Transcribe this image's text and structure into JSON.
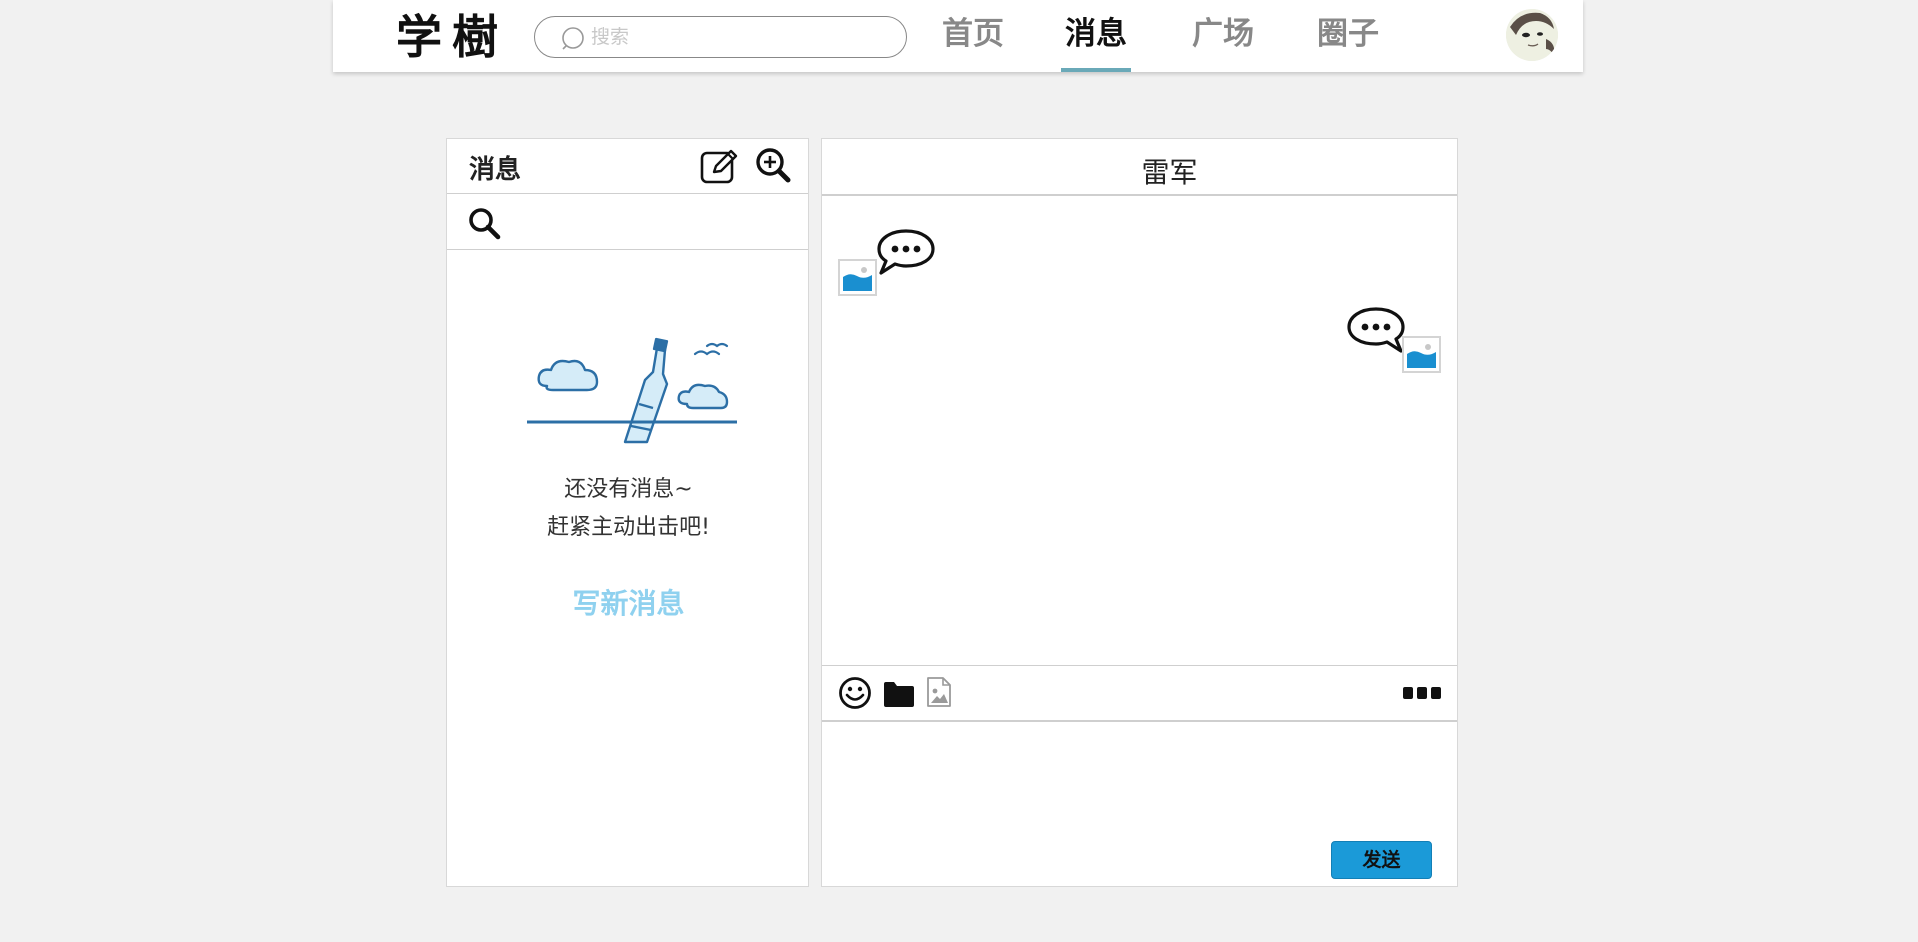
{
  "header": {
    "logo_text": "学樹",
    "search": {
      "placeholder": "搜索",
      "value": ""
    },
    "nav": [
      {
        "label": "首页",
        "active": false
      },
      {
        "label": "消息",
        "active": true
      },
      {
        "label": "广场",
        "active": false
      },
      {
        "label": "圈子",
        "active": false
      }
    ]
  },
  "messages_panel": {
    "title": "消息",
    "search": {
      "placeholder": "",
      "value": ""
    },
    "empty_line_1": "还没有消息~",
    "empty_line_2": "赶紧主动出击吧!",
    "write_new_label": "写新消息"
  },
  "chat_panel": {
    "contact_name": "雷军",
    "compose": {
      "placeholder": "",
      "value": ""
    },
    "send_label": "发送"
  },
  "colors": {
    "accent": "#1b9ad8",
    "nav_underline": "#6aa9b8",
    "link": "#8fd1ef",
    "illustration": "#2c6fa6",
    "page_bg": "#f1f1f1"
  }
}
